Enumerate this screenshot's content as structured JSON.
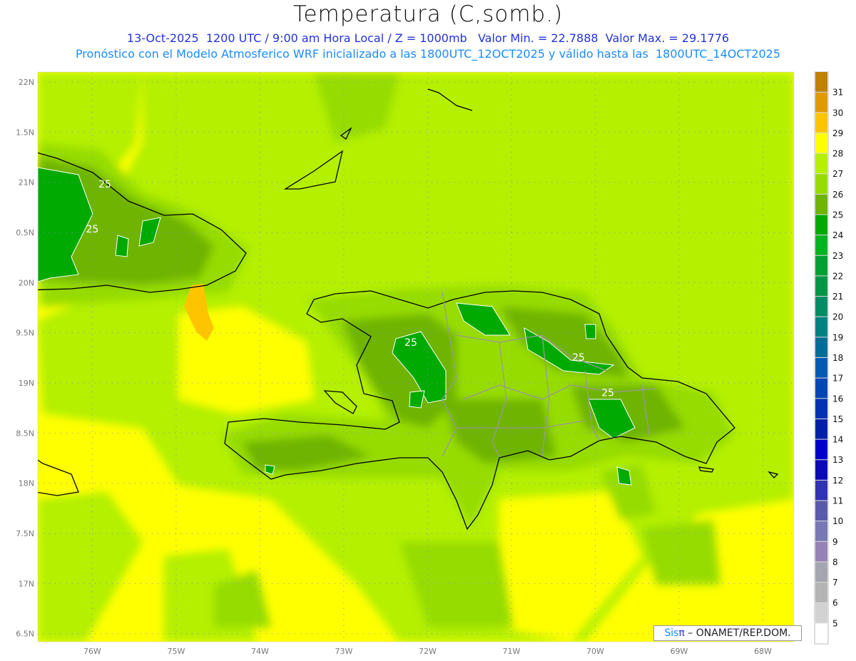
{
  "header": {
    "title": "Temperatura (C,somb.)",
    "subtitle_1": "13-Oct-2025  1200 UTC / 9:00 am Hora Local / Z = 1000mb   Valor Min. = 22.7888  Valor Max. = 29.1776",
    "subtitle_2": "Pronóstico con el Modelo Atmosferico WRF inicializado a las 1800UTC_12OCT2025 y válido hasta las  1800UTC_14OCT2025"
  },
  "map": {
    "variable": "Temperatura",
    "units": "C",
    "level": "1000mb",
    "lon_range": [
      -76.65,
      -67.63
    ],
    "lat_range": [
      16.42,
      22.1
    ],
    "lon_tick_labels": [
      "76W",
      "75W",
      "74W",
      "73W",
      "72W",
      "71W",
      "70W",
      "69W",
      "68W"
    ],
    "lat_tick_labels": [
      "22N",
      "1.5N",
      "21N",
      "0.5N",
      "20N",
      "9.5N",
      "19N",
      "8.5N",
      "18N",
      "7.5N",
      "17N",
      "6.5N"
    ],
    "contour_labels": [
      {
        "text": "25",
        "lon": -75.85,
        "lat": 20.95
      },
      {
        "text": "25",
        "lon": -76.0,
        "lat": 20.5
      },
      {
        "text": "25",
        "lon": -72.2,
        "lat": 19.37
      },
      {
        "text": "25",
        "lon": -70.2,
        "lat": 19.22
      },
      {
        "text": "25",
        "lon": -69.85,
        "lat": 18.87
      }
    ],
    "gridlines": true
  },
  "colorbar": {
    "labels": [
      "31",
      "30",
      "29",
      "28",
      "27",
      "26",
      "25",
      "24",
      "23",
      "22",
      "21",
      "20",
      "19",
      "18",
      "17",
      "16",
      "15",
      "14",
      "13",
      "12",
      "11",
      "10",
      "9",
      "8",
      "7",
      "6",
      "5"
    ],
    "colors": [
      "#c08000",
      "#e09a00",
      "#ffc400",
      "#ffff00",
      "#b4f000",
      "#96dc00",
      "#6eb400",
      "#00aa00",
      "#00b41e",
      "#00a032",
      "#009646",
      "#008c64",
      "#008282",
      "#006e96",
      "#005ab4",
      "#0046b4",
      "#0032b4",
      "#0020aa",
      "#0000c8",
      "#0a0ab4",
      "#3232b4",
      "#5a5aaa",
      "#7878b4",
      "#9682b4",
      "#a5a5b0",
      "#b4b4b4",
      "#d2d2d2",
      "#ffffff"
    ]
  },
  "credit": {
    "brand": "Sis",
    "brand_symbol": "π",
    "text": " –  ONAMET/REP.DOM."
  }
}
